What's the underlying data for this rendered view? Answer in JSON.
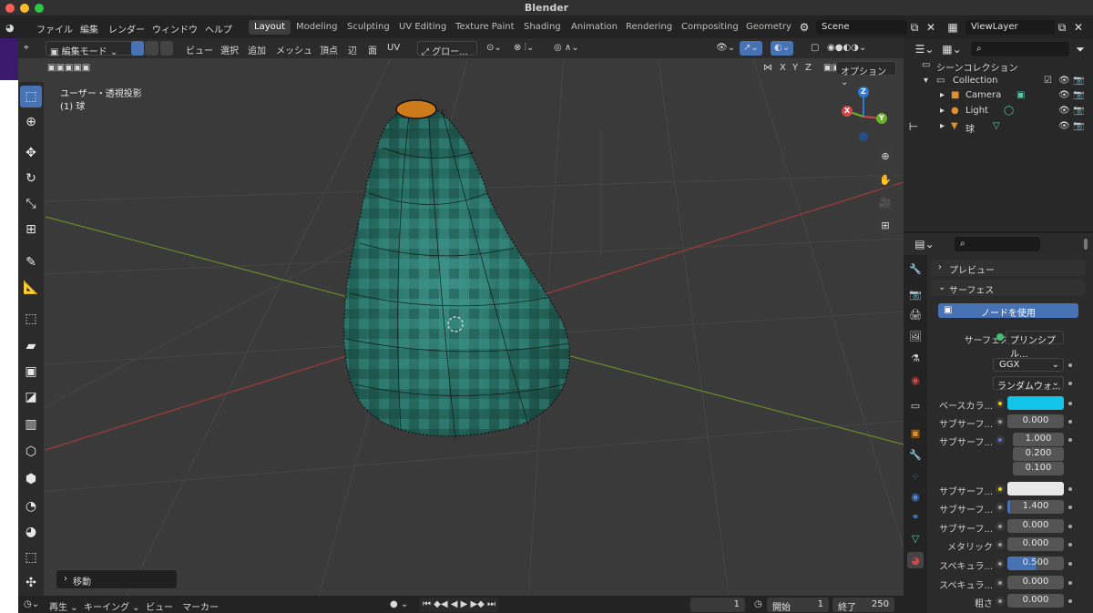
{
  "window": {
    "title": "Blender"
  },
  "menu": [
    "ファイル",
    "編集",
    "レンダー",
    "ウィンドウ",
    "ヘルプ"
  ],
  "workspaces": [
    "Layout",
    "Modeling",
    "Sculpting",
    "UV Editing",
    "Texture Paint",
    "Shading",
    "Animation",
    "Rendering",
    "Compositing",
    "Geometry"
  ],
  "active_workspace": "Layout",
  "scene": {
    "name": "Scene",
    "view_layer": "ViewLayer"
  },
  "viewport_header": {
    "mode": "編集モード",
    "menus": [
      "ビュー",
      "選択",
      "追加",
      "メッシュ",
      "頂点",
      "辺",
      "面",
      "UV"
    ],
    "orientation": "グロー...",
    "axes": [
      "X",
      "Y",
      "Z"
    ],
    "options": "オプション"
  },
  "viewport": {
    "view_name": "ユーザー・透視投影",
    "object_label": "(1) 球",
    "last_op": "移動",
    "gizmo_axes": [
      "Z",
      "Y",
      "X"
    ]
  },
  "outliner": {
    "root": "シーンコレクション",
    "collection": "Collection",
    "items": [
      {
        "name": "Camera",
        "icon": "camera-icon"
      },
      {
        "name": "Light",
        "icon": "light-icon"
      },
      {
        "name": "球",
        "icon": "mesh-icon"
      }
    ]
  },
  "properties": {
    "panels": {
      "preview": "プレビュー",
      "surface": "サーフェス"
    },
    "use_nodes_button": "ノードを使用",
    "surface_label": "サーフェス",
    "surface_shader": "プリンシプル...",
    "distribution": "GGX",
    "subsurface_method": "ランダムウォ...",
    "rows": [
      {
        "label": "ベースカラ...",
        "value": "",
        "color": "#11c4e8",
        "dot": "#e8d400"
      },
      {
        "label": "サブサーフ...",
        "value": "0.000"
      },
      {
        "label": "サブサーフ...",
        "value": "1.000",
        "dot": "#6b6bd6"
      },
      {
        "label": "",
        "value": "0.200"
      },
      {
        "label": "",
        "value": "0.100"
      },
      {
        "label": "サブサーフ...",
        "value": "",
        "color": "#e8e8e8",
        "dot": "#e8d400"
      },
      {
        "label": "サブサーフ...",
        "value": "1.400",
        "fill": 0.05
      },
      {
        "label": "サブサーフ...",
        "value": "0.000"
      },
      {
        "label": "メタリック",
        "value": "0.000"
      },
      {
        "label": "スペキュラ...",
        "value": "0.500",
        "fill": 0.5
      },
      {
        "label": "スペキュラ...",
        "value": "0.000"
      },
      {
        "label": "粗さ",
        "value": "0.000"
      }
    ]
  },
  "timeline": {
    "menus": [
      "再生",
      "キーイング",
      "ビュー",
      "マーカー"
    ],
    "current_frame": "1",
    "start_label": "開始",
    "start": "1",
    "end_label": "終了",
    "end": "250"
  },
  "colors": {
    "accent": "#4772b3",
    "viewport_bg": "#3a3a3a",
    "mesh_teal": "#1f6f64"
  }
}
